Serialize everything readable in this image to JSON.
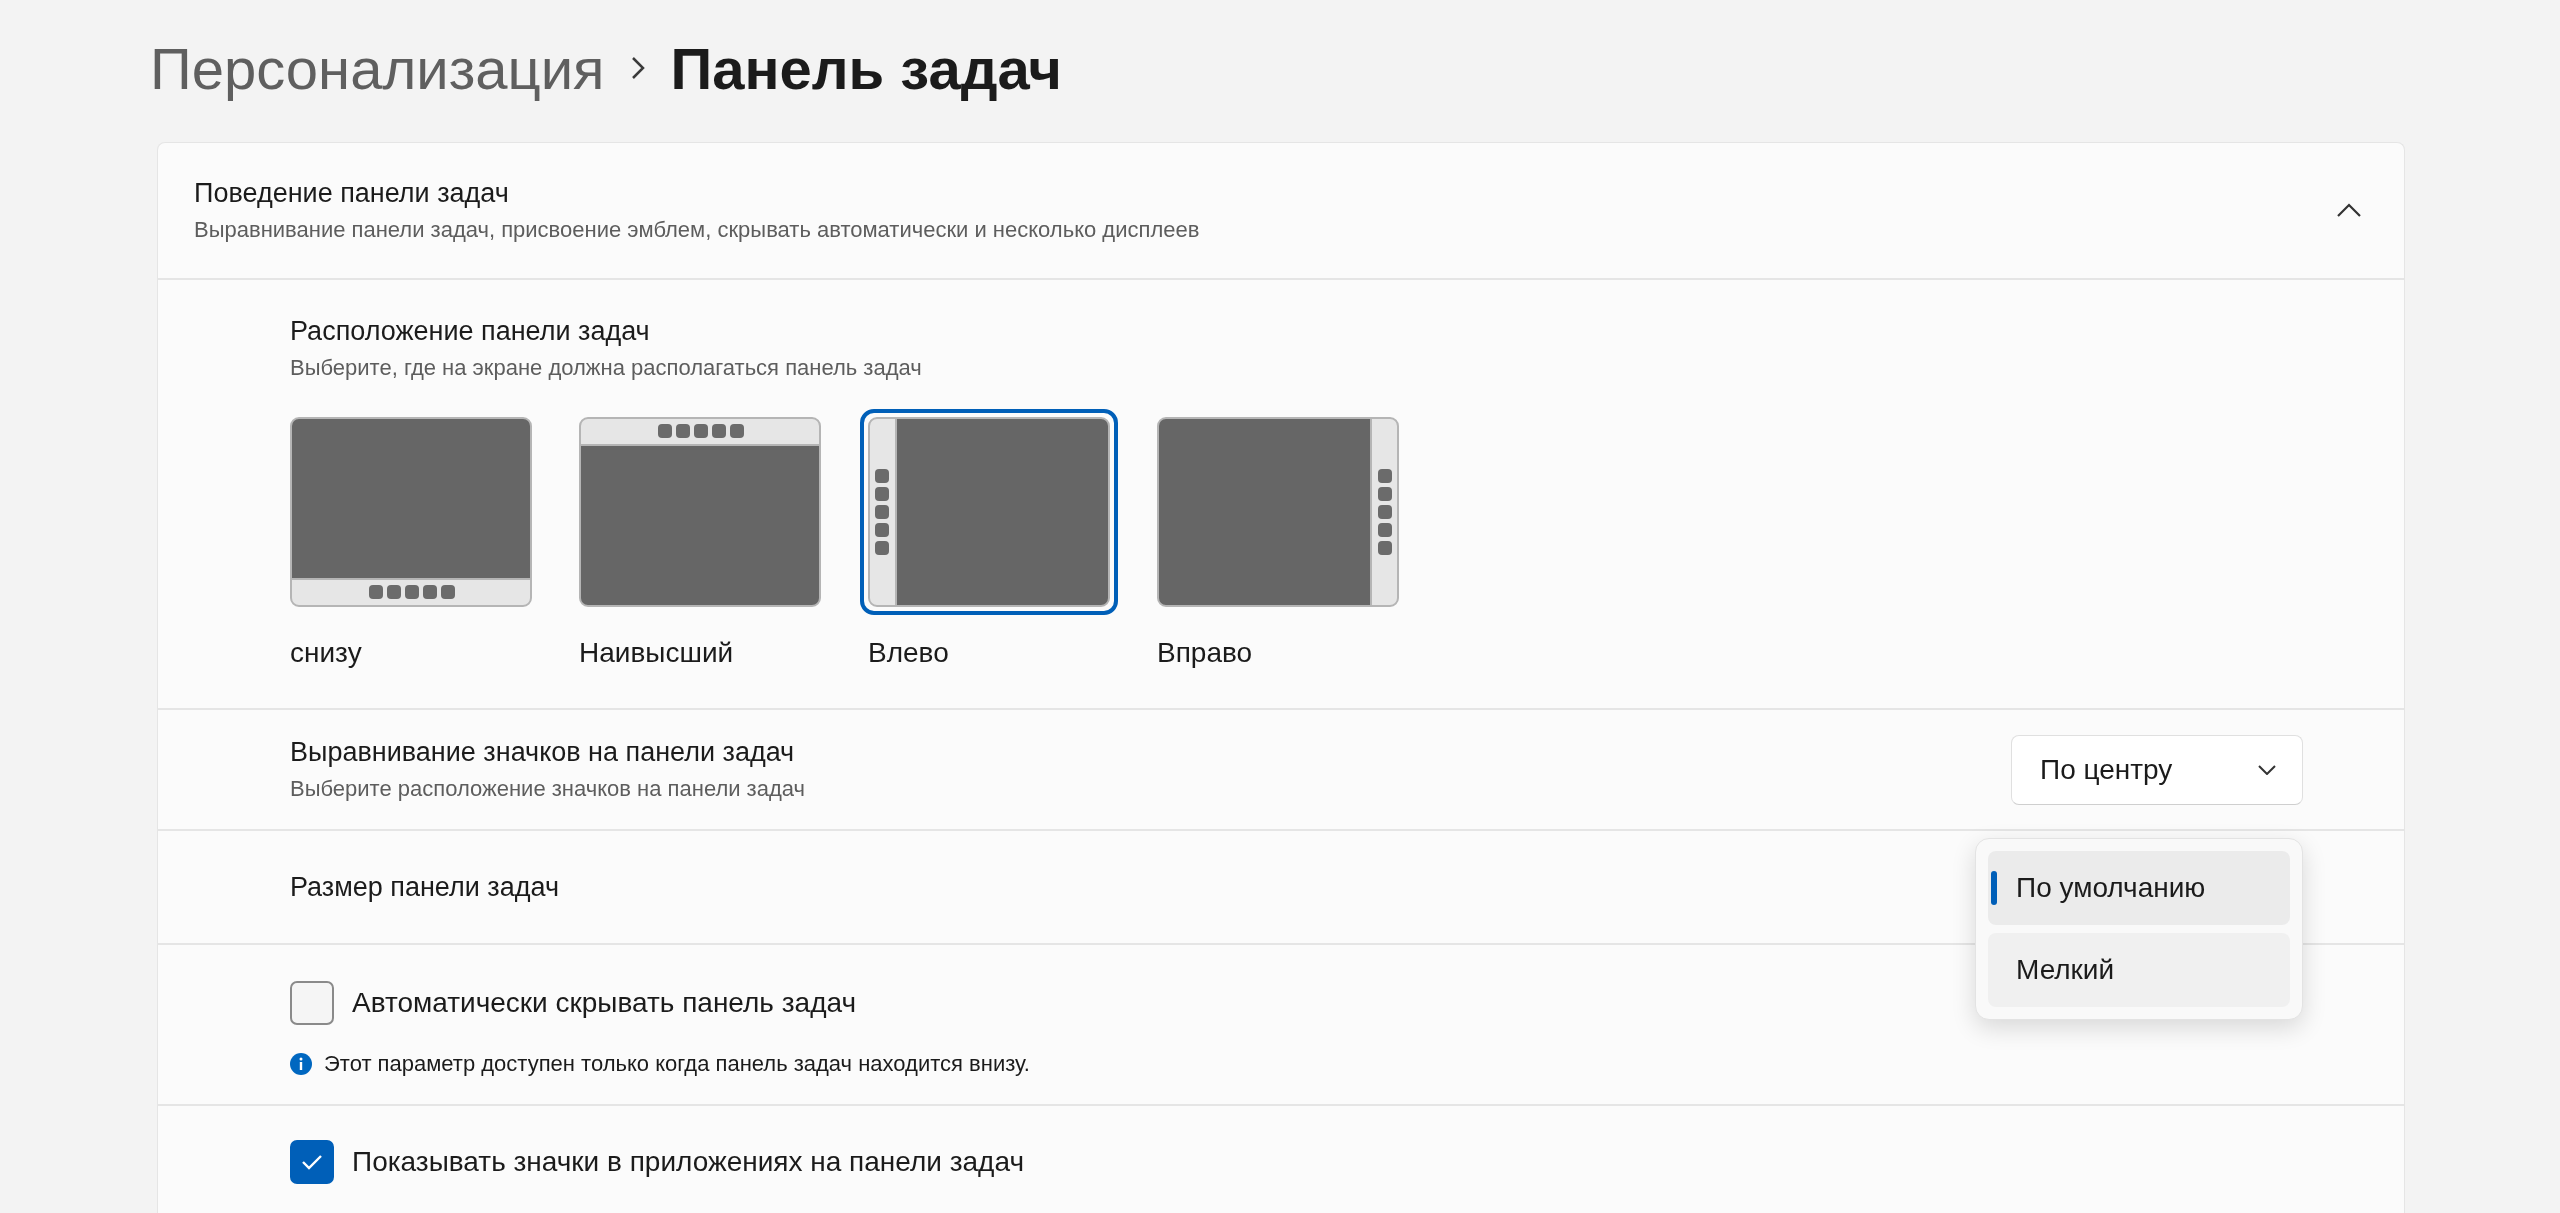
{
  "breadcrumb": {
    "parent": "Персонализация",
    "current": "Панель задач"
  },
  "behavior": {
    "title": "Поведение панели задач",
    "subtitle": "Выравнивание панели задач, присвоение эмблем, скрывать автоматически и несколько дисплеев",
    "expanded": true
  },
  "position": {
    "title": "Расположение панели задач",
    "subtitle": "Выберите, где на экране должна располагаться панель задач",
    "options": [
      {
        "label": "снизу",
        "kind": "bottom",
        "selected": false
      },
      {
        "label": "Наивысший",
        "kind": "top",
        "selected": false
      },
      {
        "label": "Влево",
        "kind": "left",
        "selected": true
      },
      {
        "label": "Вправо",
        "kind": "right",
        "selected": false
      }
    ]
  },
  "alignment": {
    "title": "Выравнивание значков на панели задач",
    "subtitle": "Выберите расположение значков на панели задач",
    "value": "По центру"
  },
  "size": {
    "title": "Размер панели задач",
    "menu": [
      {
        "label": "По умолчанию",
        "selected": true
      },
      {
        "label": "Мелкий",
        "selected": false
      }
    ]
  },
  "autohide": {
    "label": "Автоматически скрывать панель задач",
    "checked": false,
    "note": "Этот параметр доступен только когда панель задач находится внизу."
  },
  "badges": {
    "label": "Показывать значки в приложениях на панели задач",
    "checked": true
  }
}
